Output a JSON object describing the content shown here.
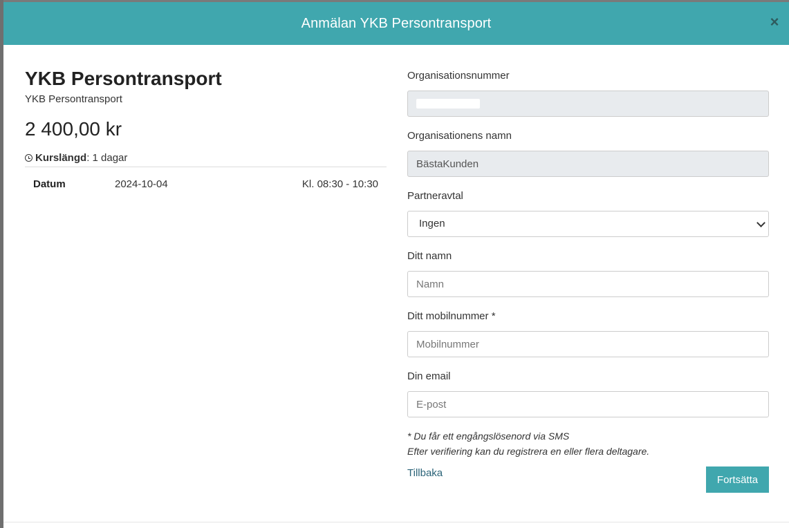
{
  "modal": {
    "title": "Anmälan YKB Persontransport",
    "close_label": "×"
  },
  "course": {
    "title": "YKB Persontransport",
    "subtitle": "YKB Persontransport",
    "price": "2 400,00 kr",
    "length_label": "Kurslängd",
    "length_value": ": 1 dagar",
    "date_label": "Datum",
    "date_value": "2024-10-04",
    "time_value": "Kl. 08:30 - 10:30"
  },
  "form": {
    "org_number_label": "Organisationsnummer",
    "org_name_label": "Organisationens namn",
    "org_name_value": "BästaKunden",
    "partner_label": "Partneravtal",
    "partner_selected": "Ingen",
    "name_label": "Ditt namn",
    "name_placeholder": "Namn",
    "mobile_label": "Ditt mobilnummer *",
    "mobile_placeholder": "Mobilnummer",
    "email_label": "Din email",
    "email_placeholder": "E-post",
    "note_line1": "* Du får ett engångslösenord via SMS",
    "note_line2": "Efter verifiering kan du registrera en eller flera deltagare.",
    "back_label": "Tillbaka",
    "continue_label": "Fortsätta"
  },
  "colors": {
    "header": "#40a7ae",
    "button": "#40a7ae",
    "link": "#2a6378",
    "readonly_bg": "#e8ebee"
  },
  "icons": {
    "close": "close-icon",
    "clock": "clock-icon",
    "select": "chevron-down-icon"
  }
}
